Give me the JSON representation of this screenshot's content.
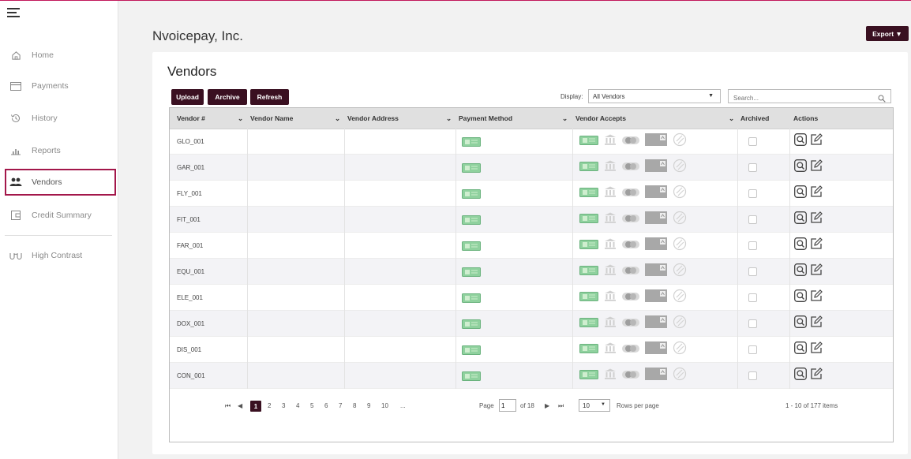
{
  "company": "Nvoicepay, Inc.",
  "export_label": "Export ▼",
  "sidebar": {
    "items": [
      {
        "label": "Home",
        "icon": "home-icon"
      },
      {
        "label": "Payments",
        "icon": "card-icon"
      },
      {
        "label": "History",
        "icon": "history-icon"
      },
      {
        "label": "Reports",
        "icon": "chart-icon"
      },
      {
        "label": "Vendors",
        "icon": "people-icon",
        "active": true
      },
      {
        "label": "Credit Summary",
        "icon": "wallet-icon"
      },
      {
        "label": "High Contrast",
        "icon": "glasses-icon"
      }
    ]
  },
  "page_title": "Vendors",
  "toolbar": {
    "upload": "Upload",
    "archive": "Archive",
    "refresh": "Refresh",
    "display_label": "Display:",
    "display_value": "All Vendors",
    "search_placeholder": "Search..."
  },
  "columns": {
    "vendor_num": "Vendor #",
    "vendor_name": "Vendor Name",
    "vendor_address": "Vendor Address",
    "payment_method": "Payment Method",
    "vendor_accepts": "Vendor Accepts",
    "archived": "Archived",
    "actions": "Actions"
  },
  "rows": [
    {
      "id": "GLO_001"
    },
    {
      "id": "GAR_001"
    },
    {
      "id": "FLY_001"
    },
    {
      "id": "FIT_001"
    },
    {
      "id": "FAR_001"
    },
    {
      "id": "EQU_001"
    },
    {
      "id": "ELE_001"
    },
    {
      "id": "DOX_001"
    },
    {
      "id": "DIS_001"
    },
    {
      "id": "CON_001"
    }
  ],
  "pager": {
    "pages": [
      "1",
      "2",
      "3",
      "4",
      "5",
      "6",
      "7",
      "8",
      "9",
      "10"
    ],
    "ellipsis": "...",
    "page_label": "Page",
    "current_page": "1",
    "of_label": "of 18",
    "rows_per_page": "10",
    "rows_per_page_label": "Rows per page",
    "summary": "1 - 10 of 177 items"
  },
  "colors": {
    "brand": "#3a1021",
    "active_border": "#a3174a",
    "check_icon": "#8bc34a"
  }
}
